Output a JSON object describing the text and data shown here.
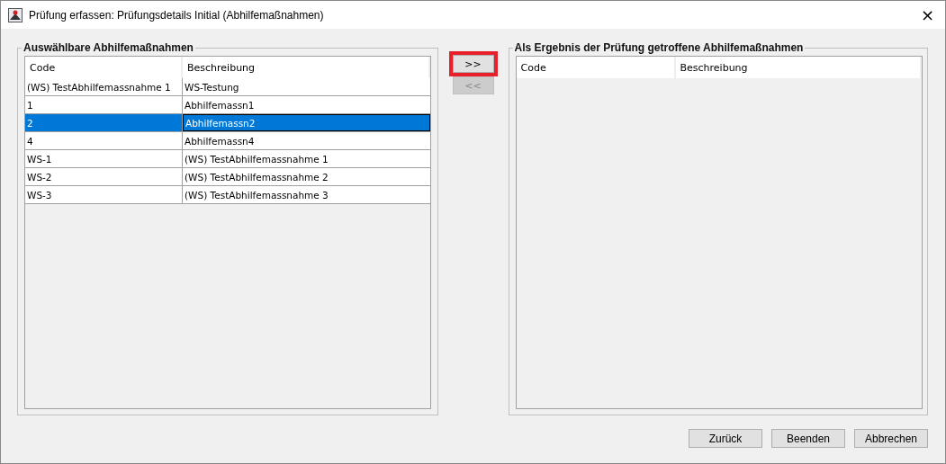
{
  "window": {
    "title": "Prüfung erfassen: Prüfungsdetails Initial (Abhilfemaßnahmen)",
    "close": "×"
  },
  "left_panel": {
    "title": "Auswählbare Abhilfemaßnahmen",
    "columns": [
      "Code",
      "Beschreibung"
    ],
    "rows": [
      {
        "cells": [
          "(WS) TestAbhilfemassnahme 1",
          "WS-Testung"
        ],
        "selected": false
      },
      {
        "cells": [
          "1",
          "Abhilfemassn1"
        ],
        "selected": false
      },
      {
        "cells": [
          "2",
          "Abhilfemassn2"
        ],
        "selected": true
      },
      {
        "cells": [
          "4",
          "Abhilfemassn4"
        ],
        "selected": false
      },
      {
        "cells": [
          "WS-1",
          "(WS) TestAbhilfemassnahme 1"
        ],
        "selected": false
      },
      {
        "cells": [
          "WS-2",
          "(WS) TestAbhilfemassnahme 2"
        ],
        "selected": false
      },
      {
        "cells": [
          "WS-3",
          "(WS) TestAbhilfemassnahme 3"
        ],
        "selected": false
      }
    ]
  },
  "transfer_buttons": [
    {
      "label": ">>",
      "disabled": false,
      "highlighted": true
    },
    {
      "label": "<<",
      "disabled": true,
      "highlighted": false
    }
  ],
  "right_panel": {
    "title": "Als Ergebnis der Prüfung getroffene Abhilfemaßnahmen",
    "columns": [
      "Code",
      "Beschreibung"
    ]
  },
  "buttons": [
    "Zurück",
    "Beenden",
    "Abbrechen"
  ]
}
